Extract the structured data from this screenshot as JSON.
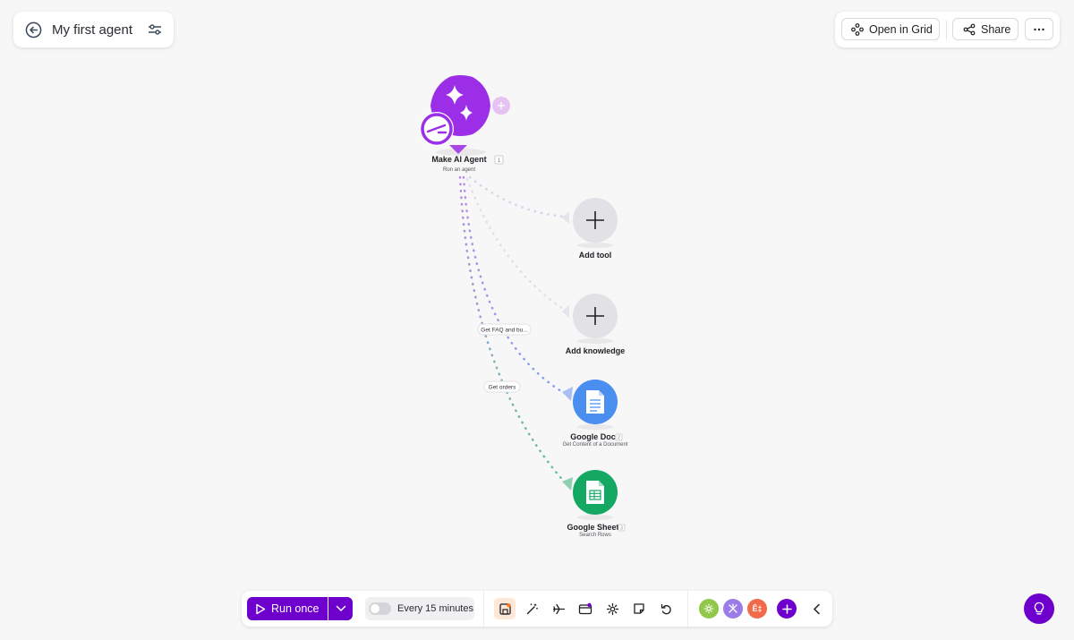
{
  "header": {
    "title": "My first agent",
    "back_icon": "arrow-left-circle-icon",
    "settings_icon": "sliders-icon"
  },
  "actions": {
    "open_grid_label": "Open in Grid",
    "share_label": "Share",
    "more_icon": "ellipsis-icon"
  },
  "nodes": {
    "agent": {
      "title": "Make AI Agent",
      "badge": "1",
      "subtitle": "Run an agent",
      "color": "#9b2ee6"
    },
    "add_tool": {
      "title": "Add tool"
    },
    "add_knowledge": {
      "title": "Add knowledge"
    },
    "docs": {
      "title": "Google Docs",
      "badge": "2",
      "subtitle": "Get Content of a Document",
      "color": "#4a8ef0"
    },
    "sheets": {
      "title": "Google Sheets",
      "badge": "3",
      "subtitle": "Search Rows",
      "color": "#14a862"
    }
  },
  "links": {
    "docs_label": "Get FAQ and bu...",
    "sheets_label": "Get orders"
  },
  "toolbar": {
    "run_label": "Run once",
    "schedule_label": "Every 15 minutes",
    "accent": "#6d00cc",
    "icons": [
      "save-icon",
      "magic-wand-icon",
      "airplane-icon",
      "devtool-icon",
      "gear-icon",
      "note-icon",
      "undo-icon"
    ],
    "apps": [
      {
        "name": "tools-app",
        "color": "#8fc84a",
        "text": ""
      },
      {
        "name": "flow-control-app",
        "color": "#9a7ce8",
        "text": ""
      },
      {
        "name": "text-parser-app",
        "color": "#f26a4a",
        "text": "Ê‡"
      }
    ],
    "add_icon": "plus-circle-icon",
    "collapse_icon": "chevron-left-icon"
  },
  "help_icon": "lightbulb-icon"
}
